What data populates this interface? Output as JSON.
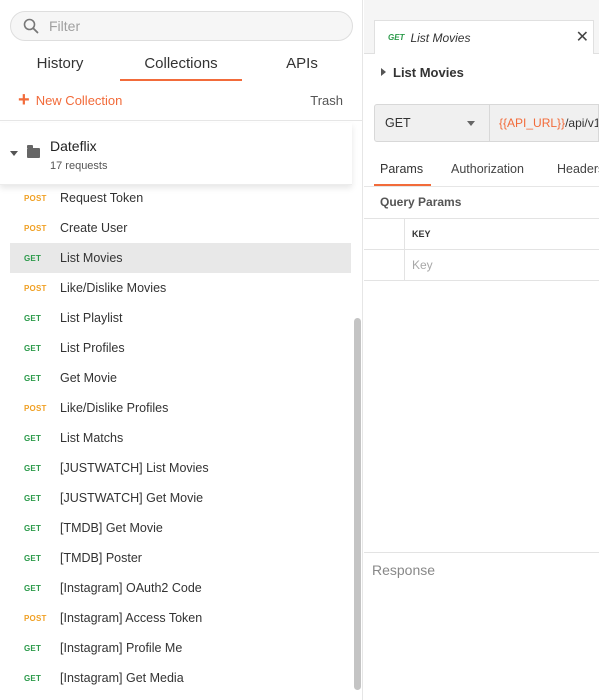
{
  "search": {
    "placeholder": "Filter"
  },
  "tabs": [
    {
      "label": "History",
      "active": false
    },
    {
      "label": "Collections",
      "active": true
    },
    {
      "label": "APIs",
      "active": false
    }
  ],
  "actions": {
    "new_collection": "New Collection",
    "trash": "Trash"
  },
  "collection": {
    "name": "Dateflix",
    "count": "17 requests"
  },
  "requests": [
    {
      "method": "POST",
      "name": "Request Token",
      "selected": false
    },
    {
      "method": "POST",
      "name": "Create User",
      "selected": false
    },
    {
      "method": "GET",
      "name": "List Movies",
      "selected": true
    },
    {
      "method": "POST",
      "name": "Like/Dislike Movies",
      "selected": false
    },
    {
      "method": "GET",
      "name": "List Playlist",
      "selected": false
    },
    {
      "method": "GET",
      "name": "List Profiles",
      "selected": false
    },
    {
      "method": "GET",
      "name": "Get Movie",
      "selected": false
    },
    {
      "method": "POST",
      "name": "Like/Dislike Profiles",
      "selected": false
    },
    {
      "method": "GET",
      "name": "List Matchs",
      "selected": false
    },
    {
      "method": "GET",
      "name": "[JUSTWATCH] List Movies",
      "selected": false
    },
    {
      "method": "GET",
      "name": "[JUSTWATCH] Get Movie",
      "selected": false
    },
    {
      "method": "GET",
      "name": "[TMDB] Get Movie",
      "selected": false
    },
    {
      "method": "GET",
      "name": "[TMDB] Poster",
      "selected": false
    },
    {
      "method": "GET",
      "name": "[Instagram] OAuth2 Code",
      "selected": false
    },
    {
      "method": "POST",
      "name": "[Instagram] Access Token",
      "selected": false
    },
    {
      "method": "GET",
      "name": "[Instagram] Profile Me",
      "selected": false
    },
    {
      "method": "GET",
      "name": "[Instagram] Get Media",
      "selected": false
    }
  ],
  "request_tab": {
    "method": "GET",
    "name": "List Movies"
  },
  "request_title": "List Movies",
  "url_bar": {
    "method": "GET",
    "url_var": "{{API_URL}}",
    "url_path": "/api/v1"
  },
  "sub_tabs": [
    {
      "label": "Params",
      "active": true
    },
    {
      "label": "Authorization",
      "active": false
    },
    {
      "label": "Headers",
      "active": false
    }
  ],
  "query_params": {
    "label": "Query Params",
    "key_header": "KEY",
    "key_placeholder": "Key"
  },
  "response": {
    "label": "Response"
  },
  "colors": {
    "accent": "#f26b3a",
    "get": "#2b9a4a",
    "post": "#f0a024"
  },
  "icons": {
    "search": "search-icon",
    "folder": "folder-icon",
    "close": "close-icon"
  }
}
